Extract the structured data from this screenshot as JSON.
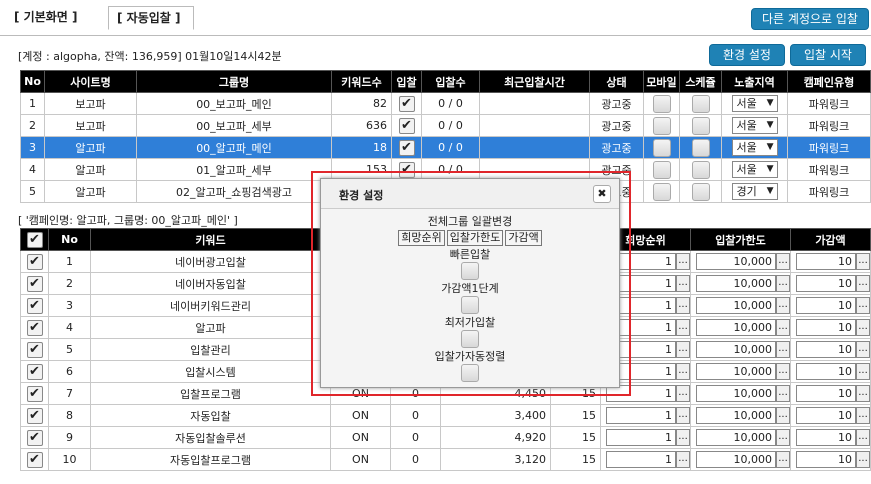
{
  "tabs": {
    "basic": "[ 기본화면 ]",
    "auto": "[ 자동입찰 ]"
  },
  "buttons": {
    "switch_account": "다른 계정으로 입찰",
    "settings": "환경 설정",
    "start_bid": "입찰 시작"
  },
  "account_info": "[계정 : algopha, 잔액: 136,959] 01월10일14시42분",
  "top_table": {
    "headers": [
      "No",
      "사이트명",
      "그룹명",
      "키워드수",
      "입찰",
      "입찰수",
      "최근입찰시간",
      "상태",
      "모바일",
      "스케쥴",
      "노출지역",
      "캠페인유형"
    ],
    "rows": [
      {
        "no": "1",
        "site": "보고파",
        "group": "00_보고파_메인",
        "kw": "82",
        "checked": true,
        "bids": "0 / 0",
        "time": "",
        "status": "광고중",
        "region": "서울",
        "type": "파워링크"
      },
      {
        "no": "2",
        "site": "보고파",
        "group": "00_보고파_세부",
        "kw": "636",
        "checked": true,
        "bids": "0 / 0",
        "time": "",
        "status": "광고중",
        "region": "서울",
        "type": "파워링크"
      },
      {
        "no": "3",
        "site": "알고파",
        "group": "00_알고파_메인",
        "kw": "18",
        "checked": true,
        "bids": "0 / 0",
        "time": "",
        "status": "광고중",
        "region": "서울",
        "type": "파워링크",
        "selected": true
      },
      {
        "no": "4",
        "site": "알고파",
        "group": "01_알고파_세부",
        "kw": "153",
        "checked": true,
        "bids": "0 / 0",
        "time": "",
        "status": "광고중",
        "region": "서울",
        "type": "파워링크"
      },
      {
        "no": "5",
        "site": "알고파",
        "group": "02_알고파_쇼핑검색광고",
        "kw": "",
        "checked": false,
        "bids": "",
        "time": "",
        "status": "광고중",
        "region": "경기",
        "type": "파워링크"
      }
    ]
  },
  "campaign_info": "[ '캠페인명: 알고파, 그룹명: 00_알고파_메인' ]",
  "bottom_table": {
    "headers": [
      "No",
      "키워드",
      "희망순위",
      "입찰가한도",
      "가감액"
    ],
    "rows": [
      {
        "no": "1",
        "kw": "네이버광고입찰",
        "on": "",
        "zero": "",
        "price": "",
        "rank": "",
        "hope": "1",
        "limit": "10,000",
        "adj": "10"
      },
      {
        "no": "2",
        "kw": "네이버자동입찰",
        "on": "",
        "zero": "",
        "price": "",
        "rank": "",
        "hope": "1",
        "limit": "10,000",
        "adj": "10"
      },
      {
        "no": "3",
        "kw": "네이버키워드관리",
        "on": "",
        "zero": "",
        "price": "",
        "rank": "",
        "hope": "1",
        "limit": "10,000",
        "adj": "10"
      },
      {
        "no": "4",
        "kw": "알고파",
        "on": "",
        "zero": "",
        "price": "",
        "rank": "",
        "hope": "1",
        "limit": "10,000",
        "adj": "10"
      },
      {
        "no": "5",
        "kw": "입찰관리",
        "on": "",
        "zero": "",
        "price": "",
        "rank": "",
        "hope": "1",
        "limit": "10,000",
        "adj": "10"
      },
      {
        "no": "6",
        "kw": "입찰시스템",
        "on": "",
        "zero": "",
        "price": "",
        "rank": "",
        "hope": "1",
        "limit": "10,000",
        "adj": "10"
      },
      {
        "no": "7",
        "kw": "입찰프로그램",
        "on": "ON",
        "zero": "0",
        "price": "4,450",
        "rank": "15",
        "hope": "1",
        "limit": "10,000",
        "adj": "10"
      },
      {
        "no": "8",
        "kw": "자동입찰",
        "on": "ON",
        "zero": "0",
        "price": "3,400",
        "rank": "15",
        "hope": "1",
        "limit": "10,000",
        "adj": "10"
      },
      {
        "no": "9",
        "kw": "자동입찰솔루션",
        "on": "ON",
        "zero": "0",
        "price": "4,920",
        "rank": "15",
        "hope": "1",
        "limit": "10,000",
        "adj": "10"
      },
      {
        "no": "10",
        "kw": "자동입찰프로그램",
        "on": "ON",
        "zero": "0",
        "price": "3,120",
        "rank": "15",
        "hope": "1",
        "limit": "10,000",
        "adj": "10"
      }
    ]
  },
  "popup": {
    "title": "환경 설정",
    "close": "✖",
    "bulk_label": "전체그룹 일괄변경",
    "bulk_buttons": [
      "희망순위",
      "입찰가한도",
      "가감액"
    ],
    "options": [
      "빠른입찰",
      "가감액1단계",
      "최저가입찰",
      "입찰가자동정렬"
    ]
  },
  "select_arrow": "▼",
  "check_mark": "✔",
  "dots": "..."
}
